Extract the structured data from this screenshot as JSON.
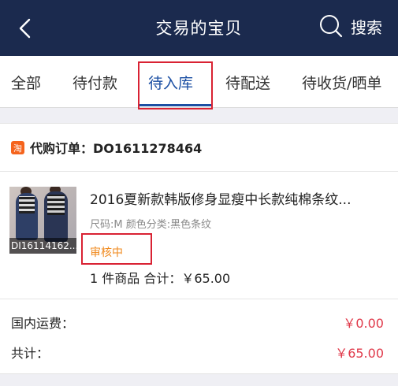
{
  "header": {
    "title": "交易的宝贝",
    "search_label": "搜索",
    "bg_color": "#1b2a4e"
  },
  "tabs": [
    {
      "label": "全部"
    },
    {
      "label": "待付款"
    },
    {
      "label": "待入库",
      "active": true
    },
    {
      "label": "待配送"
    },
    {
      "label": "待收货/晒单"
    }
  ],
  "order": {
    "icon_text": "淘",
    "label": "代购订单：DO1611278464"
  },
  "product": {
    "thumbnail_caption": "DI16114162...",
    "title": "2016夏新款韩版修身显瘦中长款纯棉条纹...",
    "spec": "尺码:M 颜色分类:黑色条纹",
    "status": "审核中",
    "summary": "1 件商品  合计：￥65.00"
  },
  "fees": {
    "domestic_shipping_label": "国内运费：",
    "domestic_shipping_value": "￥0.00",
    "total_label": "共计：",
    "total_value": "￥65.00"
  },
  "colors": {
    "accent": "#1b4fa3",
    "price": "#e0394a",
    "status": "#f08a1e",
    "highlight": "#d92233"
  }
}
